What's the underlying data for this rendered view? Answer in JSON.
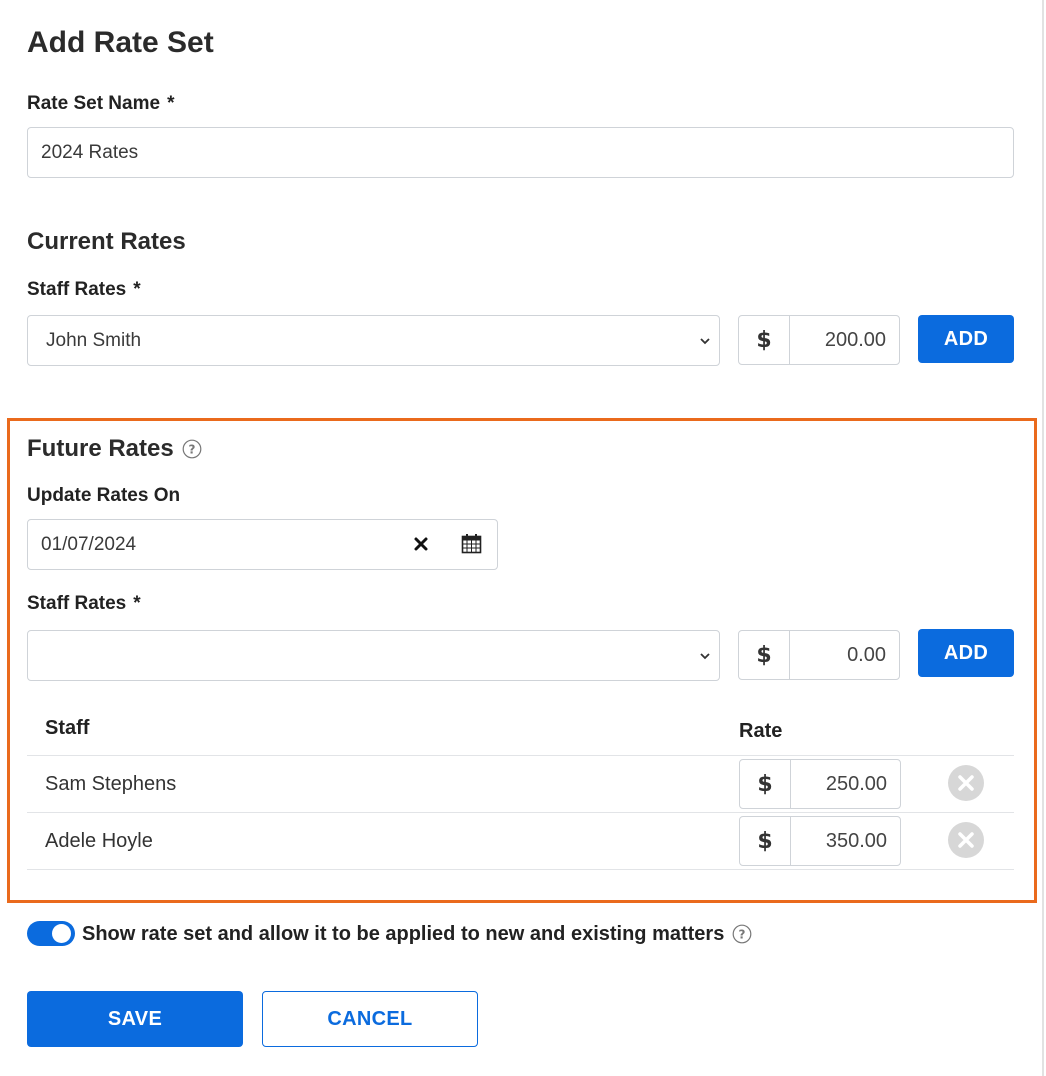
{
  "page": {
    "title": "Add Rate Set"
  },
  "rate_set_name": {
    "label": "Rate Set Name",
    "required_mark": "*",
    "value": "2024 Rates"
  },
  "current_rates": {
    "heading": "Current Rates",
    "staff_label": "Staff Rates",
    "required_mark": "*",
    "selected_staff": "John Smith",
    "currency": "$",
    "amount": "200.00",
    "add_label": "ADD"
  },
  "future_rates": {
    "heading": "Future Rates",
    "update_label": "Update Rates On",
    "date_value": "01/07/2024",
    "staff_label": "Staff Rates",
    "required_mark": "*",
    "selected_staff": "",
    "currency": "$",
    "amount": "0.00",
    "add_label": "ADD",
    "table": {
      "col_staff": "Staff",
      "col_rate": "Rate",
      "rows": [
        {
          "name": "Sam Stephens",
          "currency": "$",
          "rate": "250.00"
        },
        {
          "name": "Adele Hoyle",
          "currency": "$",
          "rate": "350.00"
        }
      ]
    }
  },
  "visibility": {
    "toggle_on": true,
    "label": "Show rate set and allow it to be applied to new and existing matters"
  },
  "actions": {
    "save_label": "SAVE",
    "cancel_label": "CANCEL"
  },
  "colors": {
    "primary": "#0b6bde",
    "highlight_border": "#ea6a1c"
  }
}
